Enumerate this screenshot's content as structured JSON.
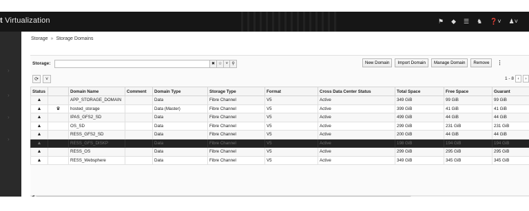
{
  "app": {
    "brand_prefix": "t",
    "title": "Virtualization"
  },
  "breadcrumb": {
    "root": "Storage",
    "separator": "»",
    "current": "Storage Domains"
  },
  "search": {
    "label": "Storage:",
    "value": "",
    "placeholder": ""
  },
  "actions": {
    "new_domain": "New Domain",
    "import_domain": "Import Domain",
    "manage_domain": "Manage Domain",
    "remove": "Remove",
    "kebab": "⋮"
  },
  "pager": {
    "range": "1 - 8",
    "prev": "‹",
    "next": "›"
  },
  "columns": [
    "Status",
    "",
    "Domain Name",
    "Comment",
    "Domain Type",
    "Storage Type",
    "Format",
    "Cross Data Center Status",
    "Total Space",
    "Free Space",
    "Guarant"
  ],
  "rows": [
    {
      "status": "▲",
      "icon": "",
      "name": "APP_STORAGE_DOMAIN",
      "comment": "",
      "type": "Data",
      "storage_type": "Fibre Channel",
      "format": "V5",
      "cross_status": "Active",
      "total": "349 GiB",
      "free": "99 GiB",
      "guaranteed": "99 GiB",
      "selected": false
    },
    {
      "status": "▲",
      "icon": "♛",
      "name": "hosted_storage",
      "comment": "",
      "type": "Data (Master)",
      "storage_type": "Fibre Channel",
      "format": "V5",
      "cross_status": "Active",
      "total": "399 GiB",
      "free": "41 GiB",
      "guaranteed": "41 GiB",
      "selected": false
    },
    {
      "status": "▲",
      "icon": "",
      "name": "IPAS_GFS2_SD",
      "comment": "",
      "type": "Data",
      "storage_type": "Fibre Channel",
      "format": "V5",
      "cross_status": "Active",
      "total": "499 GiB",
      "free": "44 GiB",
      "guaranteed": "44 GiB",
      "selected": false
    },
    {
      "status": "▲",
      "icon": "",
      "name": "OS_SD",
      "comment": "",
      "type": "Data",
      "storage_type": "Fibre Channel",
      "format": "V5",
      "cross_status": "Active",
      "total": "299 GiB",
      "free": "231 GiB",
      "guaranteed": "231 GiB",
      "selected": false
    },
    {
      "status": "▲",
      "icon": "",
      "name": "RESS_GFS2_SD",
      "comment": "",
      "type": "Data",
      "storage_type": "Fibre Channel",
      "format": "V5",
      "cross_status": "Active",
      "total": "200 GiB",
      "free": "44 GiB",
      "guaranteed": "44 GiB",
      "selected": false
    },
    {
      "status": "▲",
      "icon": "",
      "name": "RESS_GFS_DISKP",
      "comment": "",
      "type": "Data",
      "storage_type": "Fibre Channel",
      "format": "V5",
      "cross_status": "Active",
      "total": "198 GiB",
      "free": "194 GiB",
      "guaranteed": "194 GiB",
      "selected": true
    },
    {
      "status": "▲",
      "icon": "",
      "name": "RESS_OS",
      "comment": "",
      "type": "Data",
      "storage_type": "Fibre Channel",
      "format": "V5",
      "cross_status": "Active",
      "total": "299 GiB",
      "free": "295 GiB",
      "guaranteed": "295 GiB",
      "selected": false
    },
    {
      "status": "▲",
      "icon": "",
      "name": "RESS_Websphere",
      "comment": "",
      "type": "Data",
      "storage_type": "Fibre Channel",
      "format": "V5",
      "cross_status": "Active",
      "total": "349 GiB",
      "free": "345 GiB",
      "guaranteed": "345 GiB",
      "selected": false
    }
  ],
  "topbar_icons": [
    "bookmark-icon",
    "tag-icon",
    "tasks-icon",
    "bell-icon",
    "help-icon",
    "user-icon"
  ]
}
